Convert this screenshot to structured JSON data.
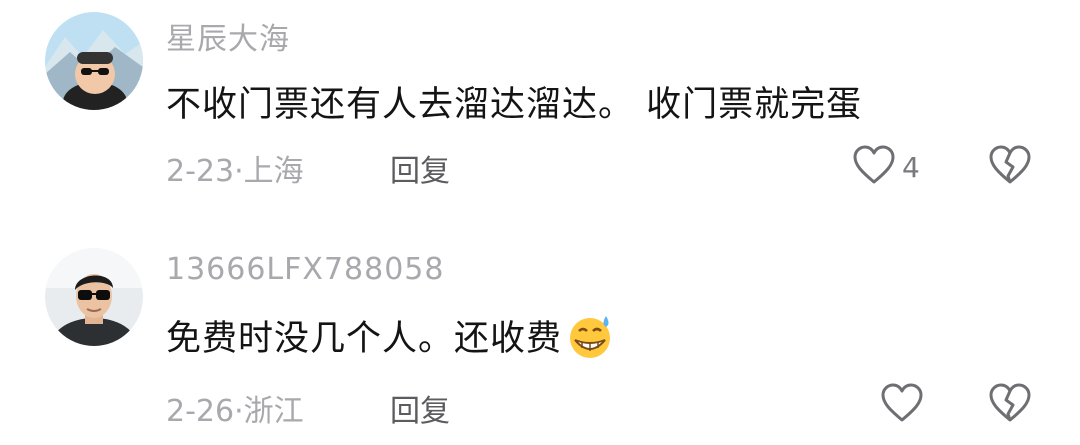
{
  "comments": [
    {
      "username": "星辰大海",
      "text": "不收门票还有人去溜达溜达。 收门票就完蛋",
      "date": "2-23·",
      "location": "上海",
      "reply_label": "回复",
      "like_count": "4",
      "avatar_icon": "cartoon-avatar-mountain",
      "emoji_icon": null
    },
    {
      "username": "13666LFX788058",
      "text": "免费时没几个人。还收费",
      "date": "2-26·",
      "location": "浙江",
      "reply_label": "回复",
      "like_count": "",
      "avatar_icon": "photo-avatar-man-sunglasses",
      "emoji_icon": "grinning-sweat-emoji"
    }
  ],
  "icons": {
    "like": "heart-outline-icon",
    "dislike": "broken-heart-icon"
  },
  "colors": {
    "username": "#a9a9ad",
    "text": "#141414",
    "meta": "#a9a9ad",
    "reply": "#5c5c60",
    "icon": "#6f6f73"
  }
}
